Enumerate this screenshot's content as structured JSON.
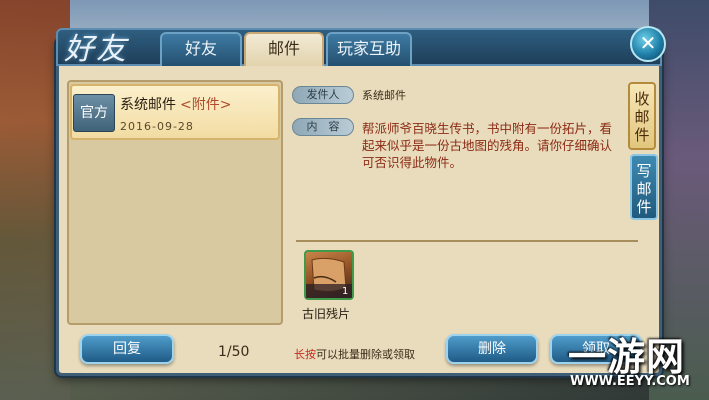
{
  "window": {
    "title": "好友",
    "tabs": [
      {
        "label": "好友",
        "active": false
      },
      {
        "label": "邮件",
        "active": true
      },
      {
        "label": "玩家互助",
        "active": false
      }
    ],
    "close_icon": "close-x-icon"
  },
  "mail_list": {
    "items": [
      {
        "badge": "官方",
        "title": "系统邮件",
        "attachment_tag": "<附件>",
        "date": "2016-09-28"
      }
    ]
  },
  "mail_detail": {
    "sender_label": "发件人",
    "sender": "系统邮件",
    "content_label": "内　容",
    "content": "帮派师爷百晓生传书，书中附有一份拓片，看起来似乎是一份古地图的残角。请你仔细确认可否识得此物件。",
    "attachments": [
      {
        "name": "古旧残片",
        "quantity": "1"
      }
    ]
  },
  "side_tabs": {
    "inbox": "收邮件",
    "compose": "写邮件"
  },
  "footer": {
    "reply_label": "回复",
    "page": "1/50",
    "hint_strong": "长按",
    "hint_rest": "可以批量删除或领取",
    "delete_label": "删除",
    "claim_label": "领取"
  },
  "watermark": {
    "brand": "一游网",
    "url": "WWW.EEYY.COM"
  },
  "colors": {
    "panel_bg": "#e8dcbd",
    "frame_blue": "#3e5f77",
    "text_red": "#8c2a14",
    "hint_red": "#c72a1a",
    "button_blue": "#1f5b86"
  }
}
